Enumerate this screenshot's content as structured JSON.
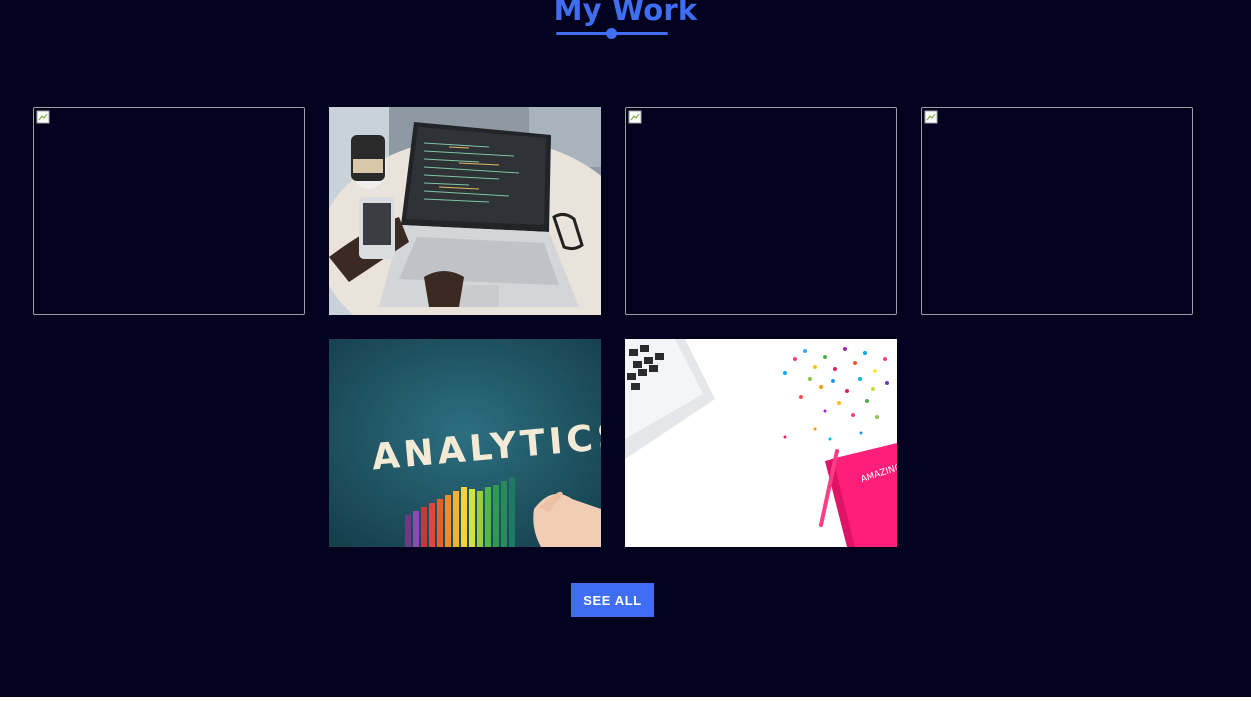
{
  "section": {
    "title": "My Work",
    "accent_color": "#3f6ef2",
    "background_color": "#04031f"
  },
  "portfolio": {
    "items": [
      {
        "image": "broken-image",
        "state": "failed-to-load"
      },
      {
        "image": "laptop-code-phone-photo",
        "state": "loaded"
      },
      {
        "image": "broken-image",
        "state": "failed-to-load"
      },
      {
        "image": "broken-image",
        "state": "failed-to-load"
      },
      {
        "image": "analytics-colored-pencils-photo",
        "state": "loaded"
      },
      {
        "image": "laptop-confetti-pink-notebook-photo",
        "state": "loaded"
      }
    ],
    "analytics_photo_text": "ANALYTICS",
    "notebook_photo_text": "AMAZING"
  },
  "actions": {
    "see_all_label": "SEE ALL"
  }
}
